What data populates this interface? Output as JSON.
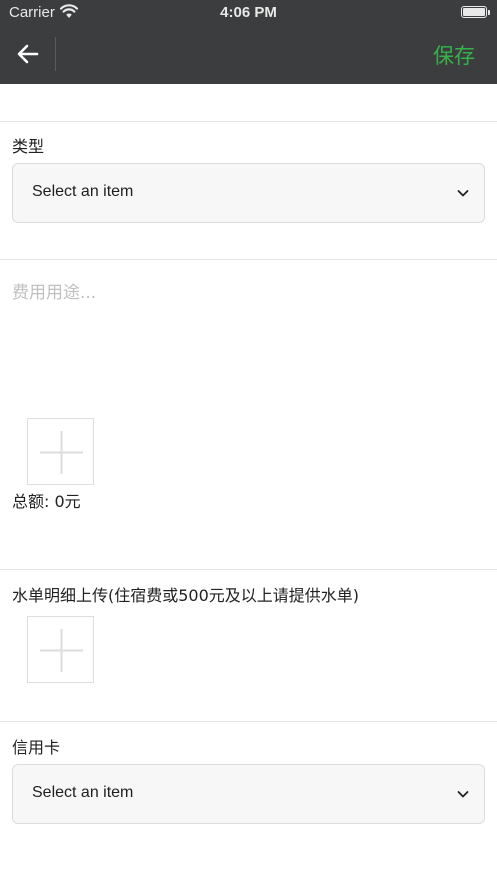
{
  "status_bar": {
    "carrier": "Carrier",
    "time": "4:06 PM"
  },
  "nav": {
    "back_icon": "arrow-left-icon",
    "save_label": "保存",
    "accent_color": "#35b34a"
  },
  "type_field": {
    "label": "类型",
    "value": "Select an item"
  },
  "purpose_field": {
    "placeholder": "费用用途..."
  },
  "total": {
    "text": "总额: 0元"
  },
  "receipt_upload": {
    "label": "水单明细上传(住宿费或500元及以上请提供水单)"
  },
  "credit_card_field": {
    "label": "信用卡",
    "value": "Select an item"
  }
}
